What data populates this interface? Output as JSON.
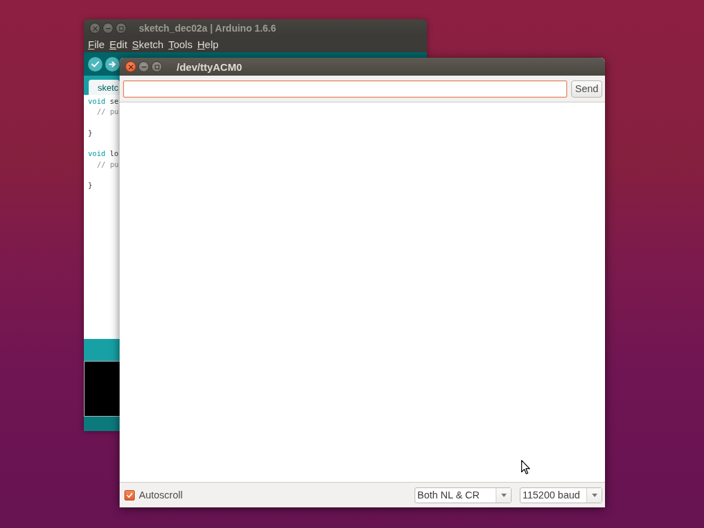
{
  "arduino_window": {
    "title": "sketch_dec02a | Arduino 1.6.6",
    "focused": false,
    "menu": [
      "File",
      "Edit",
      "Sketch",
      "Tools",
      "Help"
    ],
    "tabs": [
      {
        "label": "sketc",
        "selected": true
      }
    ],
    "code_lines": [
      {
        "kind": "code",
        "tokens": [
          {
            "kind": "keyword",
            "text": "void"
          },
          {
            "kind": "plain",
            "text": "se"
          }
        ]
      },
      {
        "kind": "indented",
        "tokens": [
          {
            "kind": "comment",
            "text": "// pu"
          }
        ]
      },
      {
        "kind": "blank"
      },
      {
        "kind": "code",
        "tokens": [
          {
            "kind": "plain",
            "text": "}"
          }
        ]
      },
      {
        "kind": "blank"
      },
      {
        "kind": "code",
        "tokens": [
          {
            "kind": "keyword",
            "text": "void"
          },
          {
            "kind": "plain",
            "text": "lo"
          }
        ]
      },
      {
        "kind": "indented",
        "tokens": [
          {
            "kind": "comment",
            "text": "// pu"
          }
        ]
      },
      {
        "kind": "blank"
      },
      {
        "kind": "code",
        "tokens": [
          {
            "kind": "plain",
            "text": "}"
          }
        ]
      }
    ]
  },
  "serial_monitor": {
    "title": "/dev/ttyACM0",
    "focused": true,
    "input": {
      "focused": true
    },
    "send_button": "Send",
    "autoscroll": {
      "label": "Autoscroll",
      "checked": true
    },
    "line_ending": {
      "value": "Both NL & CR"
    },
    "baud_rate": {
      "value": "115200 baud"
    }
  }
}
